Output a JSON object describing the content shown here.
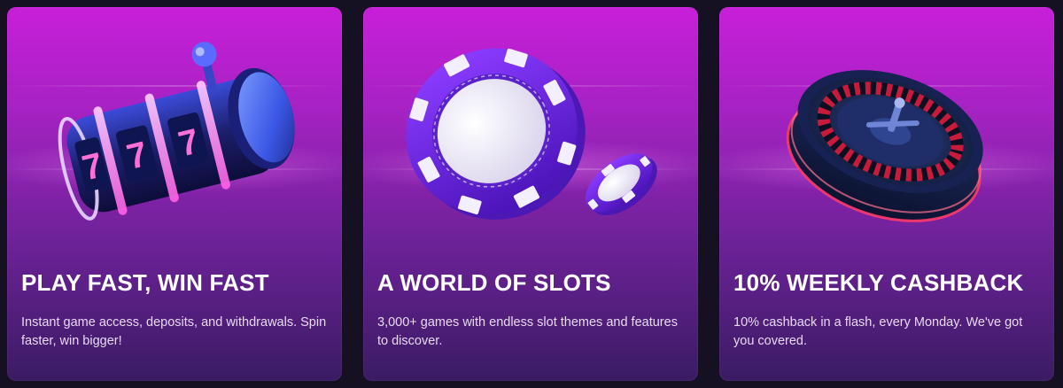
{
  "cards": [
    {
      "icon": "slot-machine-reels-icon",
      "title": "PLAY FAST, WIN FAST",
      "text": "Instant game access, deposits, and withdrawals. Spin faster, win bigger!",
      "reel_symbols": [
        "7",
        "7",
        "7"
      ]
    },
    {
      "icon": "casino-chips-icon",
      "title": "A WORLD OF SLOTS",
      "text": "3,000+ games with endless slot themes and features to discover."
    },
    {
      "icon": "roulette-wheel-icon",
      "title": "10% WEEKLY CASHBACK",
      "text": "10% cashback in a flash, every Monday. We've got you covered."
    }
  ],
  "colors": {
    "page_background": "#151022",
    "card_gradient_top": "#c81fd9",
    "card_gradient_bottom": "#3a1b63",
    "title_text": "#ffffff",
    "body_text": "#e8d9f2"
  }
}
